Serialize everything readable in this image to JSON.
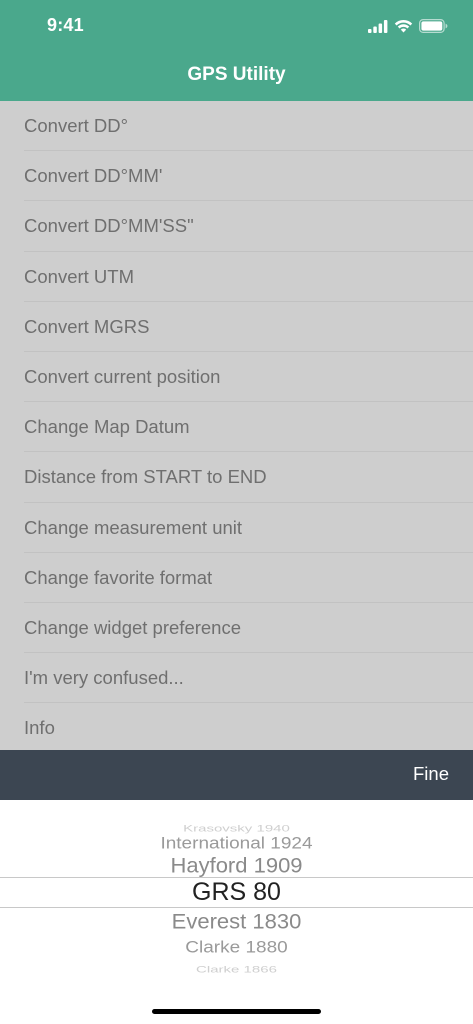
{
  "status_bar": {
    "time": "9:41",
    "signal_icon": "cellular-signal-icon",
    "wifi_icon": "wifi-icon",
    "battery_icon": "battery-icon"
  },
  "nav": {
    "title": "GPS Utility"
  },
  "menu": {
    "items": [
      "Convert DD°",
      "Convert DD°MM'",
      "Convert DD°MM'SS\"",
      "Convert UTM",
      "Convert MGRS",
      "Convert current position",
      "Change Map Datum",
      "Distance from START to END",
      "Change measurement unit",
      "Change favorite format",
      "Change widget preference",
      "I'm very confused...",
      "Info"
    ]
  },
  "toolbar": {
    "done_label": "Fine"
  },
  "picker": {
    "options": [
      "Krasovsky 1940",
      "International 1924",
      "Hayford 1909",
      "GRS 80",
      "Everest 1830",
      "Clarke 1880",
      "Clarke 1866"
    ],
    "selected": "GRS 80"
  },
  "colors": {
    "header_bg": "#4aa88c",
    "menu_bg": "#cecece",
    "menu_text": "#6f6f6f",
    "toolbar_bg": "#3c4652",
    "picker_bg": "#ffffff"
  }
}
